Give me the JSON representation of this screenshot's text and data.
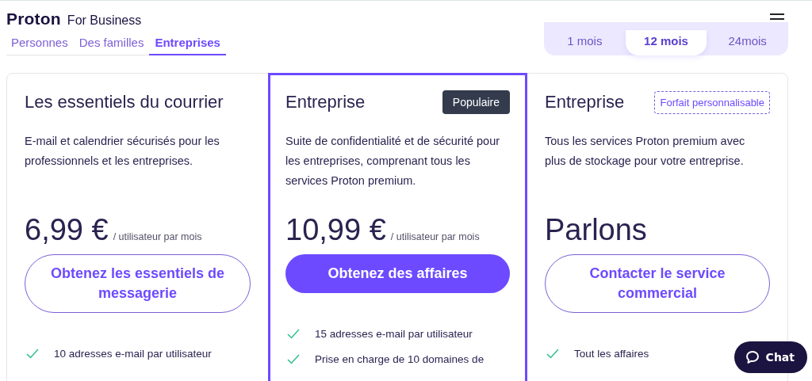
{
  "header": {
    "brand": "Proton",
    "product": "For Business"
  },
  "audience_tabs": [
    {
      "label": "Personnes",
      "selected": false
    },
    {
      "label": "Des familles",
      "selected": false
    },
    {
      "label": "Entreprises",
      "selected": true
    }
  ],
  "periods": [
    {
      "label": "1 mois",
      "selected": false
    },
    {
      "label": "12 mois",
      "selected": true
    },
    {
      "label": "24mois",
      "selected": false
    }
  ],
  "plans": [
    {
      "title": "Les essentiels du courrier",
      "featured": false,
      "description": "E-mail et calendrier sécurisés pour les professionnels et les entreprises.",
      "price": "6,99 €",
      "price_unit": "/ utilisateur par mois",
      "button": {
        "label": "Obtenez les essentiels de messagerie",
        "kind": "outline"
      },
      "features": [
        "10 adresses e-mail par utilisateur"
      ]
    },
    {
      "title": "Entreprise",
      "featured": true,
      "badge": {
        "label": "Populaire",
        "kind": "filled"
      },
      "description": "Suite de confidentialité et de sécurité pour les entreprises, comprenant tous les services Proton premium.",
      "price": "10,99 €",
      "price_unit": "/ utilisateur par mois",
      "button": {
        "label": "Obtenez des affaires",
        "kind": "filled"
      },
      "features": [
        "15 adresses e-mail par utilisateur",
        "Prise en charge de 10 domaines de"
      ]
    },
    {
      "title": "Entreprise",
      "featured": false,
      "badge": {
        "label": "Forfait personnalisable",
        "kind": "dashed"
      },
      "description": "Tous les services Proton premium avec plus de stockage pour votre entreprise.",
      "price": "Parlons",
      "button": {
        "label": "Contacter le service commercial",
        "kind": "outline"
      },
      "features": [
        "Tout les affaires"
      ]
    }
  ],
  "chat_button": {
    "label": "Chat"
  }
}
